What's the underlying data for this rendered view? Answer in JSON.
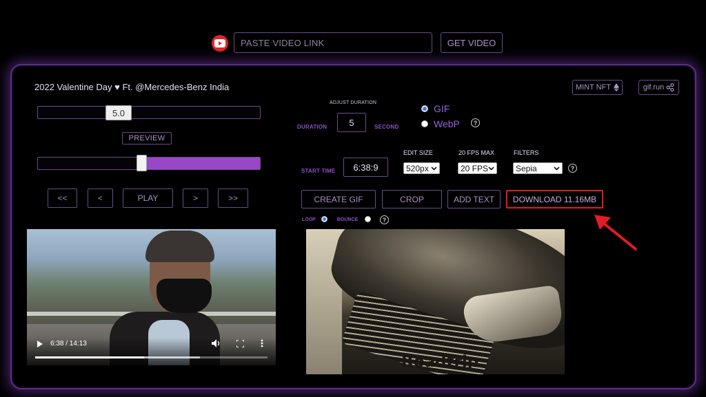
{
  "top_bar": {
    "url_placeholder": "PASTE VIDEO LINK",
    "get_button": "GET VIDEO"
  },
  "video": {
    "title": "2022 Valentine Day ♥ Ft. @Mercedes-Benz India",
    "time_display": "6:38 / 14:13",
    "played_fraction": 0.47,
    "buffered_fraction": 0.71
  },
  "header_buttons": {
    "mint": "MINT NFT",
    "gifrun": "gif.run"
  },
  "duration_slider": {
    "value": "5.0"
  },
  "preview_button": "PREVIEW",
  "position_slider": {
    "fraction": 0.47
  },
  "nav": {
    "rewind_fast": "<<",
    "rewind": "<",
    "play": "PLAY",
    "forward": ">",
    "forward_fast": ">>"
  },
  "controls": {
    "adjust_duration_label": "ADJUST DURATION",
    "duration_label": "DURATION",
    "duration_value": "5",
    "second_label": "SECOND",
    "format_gif": "GIF",
    "format_webp": "WebP",
    "selected_format": "GIF",
    "start_time_label": "START TIME",
    "start_time_value": "6:38:9",
    "edit_size_label": "EDIT SIZE",
    "edit_size_value": "520px",
    "fps_label": "20 FPS MAX",
    "fps_value": "20 FPS",
    "filters_label": "FILTERS",
    "filters_value": "Sepia"
  },
  "actions": {
    "create_gif": "CREATE GIF",
    "crop": "CROP",
    "add_text": "ADD TEXT",
    "download": "DOWNLOAD 11.16MB"
  },
  "options": {
    "loop_label": "LOOP",
    "bounce_label": "BOUNCE",
    "loop_checked": true
  },
  "gif_preview": {
    "caption": "Roadtrip"
  },
  "colors": {
    "accent_purple": "#9a46c9",
    "border_purple": "#6a4d8c",
    "highlight_red": "#e31b23"
  }
}
